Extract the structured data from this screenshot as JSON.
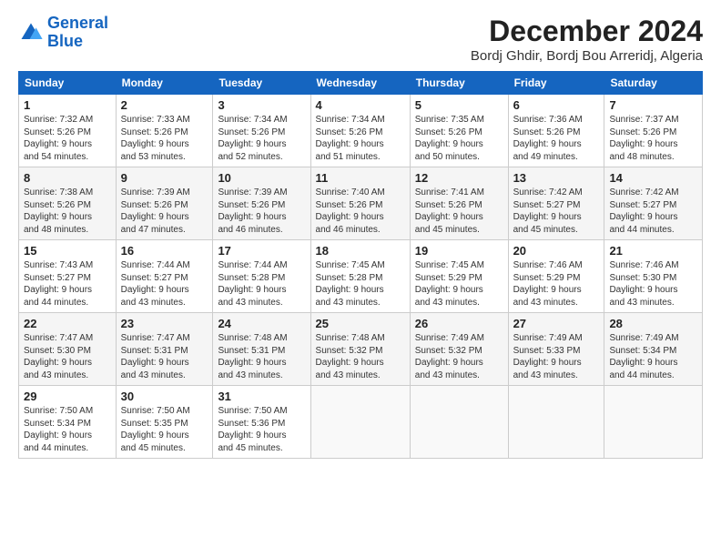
{
  "logo": {
    "line1": "General",
    "line2": "Blue"
  },
  "title": "December 2024",
  "subtitle": "Bordj Ghdir, Bordj Bou Arreridj, Algeria",
  "header_days": [
    "Sunday",
    "Monday",
    "Tuesday",
    "Wednesday",
    "Thursday",
    "Friday",
    "Saturday"
  ],
  "weeks": [
    [
      {
        "day": "1",
        "info": "Sunrise: 7:32 AM\nSunset: 5:26 PM\nDaylight: 9 hours\nand 54 minutes."
      },
      {
        "day": "2",
        "info": "Sunrise: 7:33 AM\nSunset: 5:26 PM\nDaylight: 9 hours\nand 53 minutes."
      },
      {
        "day": "3",
        "info": "Sunrise: 7:34 AM\nSunset: 5:26 PM\nDaylight: 9 hours\nand 52 minutes."
      },
      {
        "day": "4",
        "info": "Sunrise: 7:34 AM\nSunset: 5:26 PM\nDaylight: 9 hours\nand 51 minutes."
      },
      {
        "day": "5",
        "info": "Sunrise: 7:35 AM\nSunset: 5:26 PM\nDaylight: 9 hours\nand 50 minutes."
      },
      {
        "day": "6",
        "info": "Sunrise: 7:36 AM\nSunset: 5:26 PM\nDaylight: 9 hours\nand 49 minutes."
      },
      {
        "day": "7",
        "info": "Sunrise: 7:37 AM\nSunset: 5:26 PM\nDaylight: 9 hours\nand 48 minutes."
      }
    ],
    [
      {
        "day": "8",
        "info": "Sunrise: 7:38 AM\nSunset: 5:26 PM\nDaylight: 9 hours\nand 48 minutes."
      },
      {
        "day": "9",
        "info": "Sunrise: 7:39 AM\nSunset: 5:26 PM\nDaylight: 9 hours\nand 47 minutes."
      },
      {
        "day": "10",
        "info": "Sunrise: 7:39 AM\nSunset: 5:26 PM\nDaylight: 9 hours\nand 46 minutes."
      },
      {
        "day": "11",
        "info": "Sunrise: 7:40 AM\nSunset: 5:26 PM\nDaylight: 9 hours\nand 46 minutes."
      },
      {
        "day": "12",
        "info": "Sunrise: 7:41 AM\nSunset: 5:26 PM\nDaylight: 9 hours\nand 45 minutes."
      },
      {
        "day": "13",
        "info": "Sunrise: 7:42 AM\nSunset: 5:27 PM\nDaylight: 9 hours\nand 45 minutes."
      },
      {
        "day": "14",
        "info": "Sunrise: 7:42 AM\nSunset: 5:27 PM\nDaylight: 9 hours\nand 44 minutes."
      }
    ],
    [
      {
        "day": "15",
        "info": "Sunrise: 7:43 AM\nSunset: 5:27 PM\nDaylight: 9 hours\nand 44 minutes."
      },
      {
        "day": "16",
        "info": "Sunrise: 7:44 AM\nSunset: 5:27 PM\nDaylight: 9 hours\nand 43 minutes."
      },
      {
        "day": "17",
        "info": "Sunrise: 7:44 AM\nSunset: 5:28 PM\nDaylight: 9 hours\nand 43 minutes."
      },
      {
        "day": "18",
        "info": "Sunrise: 7:45 AM\nSunset: 5:28 PM\nDaylight: 9 hours\nand 43 minutes."
      },
      {
        "day": "19",
        "info": "Sunrise: 7:45 AM\nSunset: 5:29 PM\nDaylight: 9 hours\nand 43 minutes."
      },
      {
        "day": "20",
        "info": "Sunrise: 7:46 AM\nSunset: 5:29 PM\nDaylight: 9 hours\nand 43 minutes."
      },
      {
        "day": "21",
        "info": "Sunrise: 7:46 AM\nSunset: 5:30 PM\nDaylight: 9 hours\nand 43 minutes."
      }
    ],
    [
      {
        "day": "22",
        "info": "Sunrise: 7:47 AM\nSunset: 5:30 PM\nDaylight: 9 hours\nand 43 minutes."
      },
      {
        "day": "23",
        "info": "Sunrise: 7:47 AM\nSunset: 5:31 PM\nDaylight: 9 hours\nand 43 minutes."
      },
      {
        "day": "24",
        "info": "Sunrise: 7:48 AM\nSunset: 5:31 PM\nDaylight: 9 hours\nand 43 minutes."
      },
      {
        "day": "25",
        "info": "Sunrise: 7:48 AM\nSunset: 5:32 PM\nDaylight: 9 hours\nand 43 minutes."
      },
      {
        "day": "26",
        "info": "Sunrise: 7:49 AM\nSunset: 5:32 PM\nDaylight: 9 hours\nand 43 minutes."
      },
      {
        "day": "27",
        "info": "Sunrise: 7:49 AM\nSunset: 5:33 PM\nDaylight: 9 hours\nand 43 minutes."
      },
      {
        "day": "28",
        "info": "Sunrise: 7:49 AM\nSunset: 5:34 PM\nDaylight: 9 hours\nand 44 minutes."
      }
    ],
    [
      {
        "day": "29",
        "info": "Sunrise: 7:50 AM\nSunset: 5:34 PM\nDaylight: 9 hours\nand 44 minutes."
      },
      {
        "day": "30",
        "info": "Sunrise: 7:50 AM\nSunset: 5:35 PM\nDaylight: 9 hours\nand 45 minutes."
      },
      {
        "day": "31",
        "info": "Sunrise: 7:50 AM\nSunset: 5:36 PM\nDaylight: 9 hours\nand 45 minutes."
      },
      null,
      null,
      null,
      null
    ]
  ]
}
